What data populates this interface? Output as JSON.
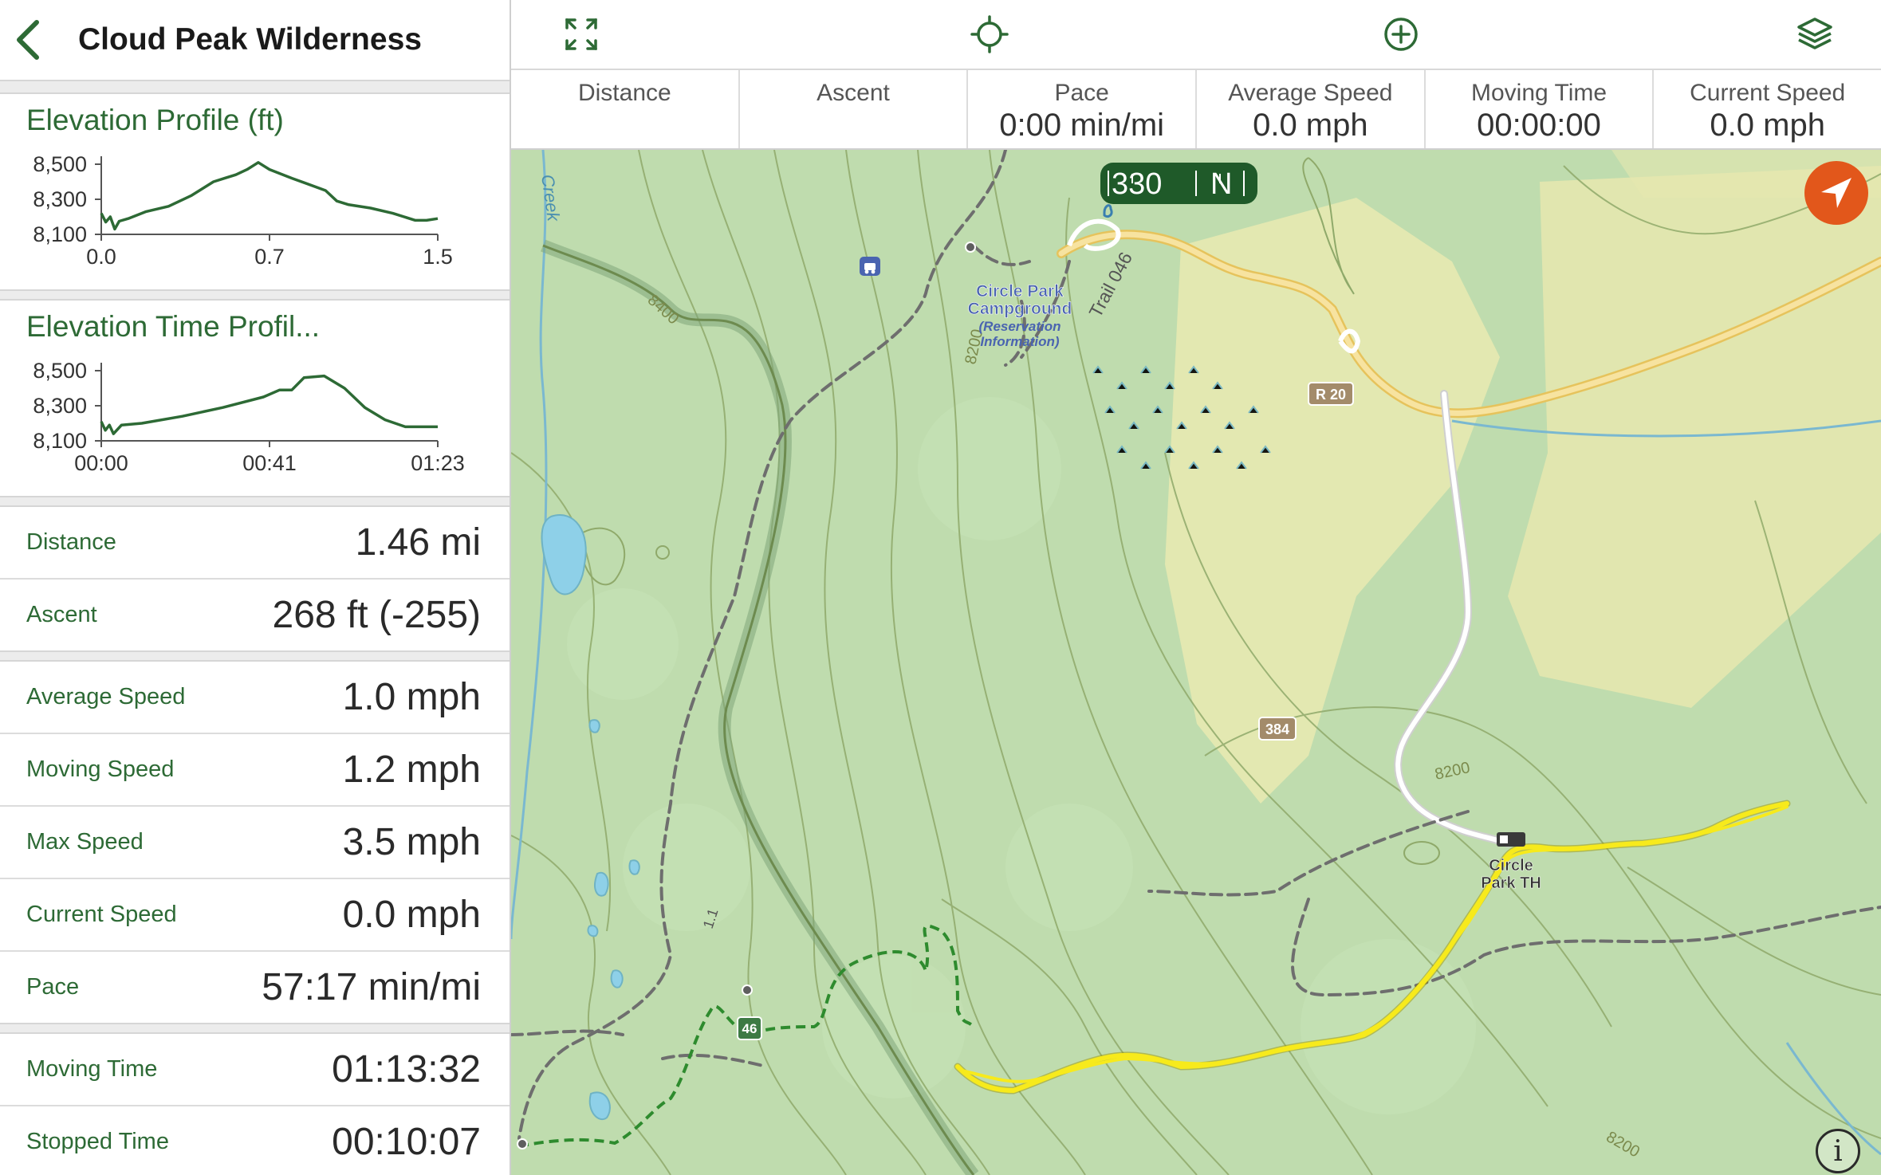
{
  "header": {
    "title": "Cloud Peak Wilderness"
  },
  "colors": {
    "accent": "#2d6a35",
    "track": "#f7ea1c",
    "fab": "#e2571b"
  },
  "charts": {
    "elevation_profile": {
      "title": "Elevation Profile (ft)",
      "y_ticks": [
        "8,500",
        "8,300",
        "8,100"
      ],
      "x_ticks": [
        "0.0",
        "0.7",
        "1.5"
      ]
    },
    "elevation_time": {
      "title": "Elevation Time Profil...",
      "y_ticks": [
        "8,500",
        "8,300",
        "8,100"
      ],
      "x_ticks": [
        "00:00",
        "00:41",
        "01:23"
      ]
    }
  },
  "chart_data": [
    {
      "type": "line",
      "title": "Elevation Profile (ft)",
      "xlabel": "",
      "ylabel": "",
      "ylim": [
        8100,
        8500
      ],
      "xlim": [
        0,
        1.5
      ],
      "series": [
        {
          "x": [
            0.0,
            0.02,
            0.04,
            0.06,
            0.08,
            0.12,
            0.2,
            0.3,
            0.4,
            0.5,
            0.55,
            0.6,
            0.65,
            0.7,
            0.75,
            0.85,
            1.0,
            1.05,
            1.1,
            1.2,
            1.3,
            1.4,
            1.45,
            1.5
          ],
          "values": [
            8220,
            8170,
            8200,
            8130,
            8175,
            8190,
            8230,
            8260,
            8320,
            8400,
            8420,
            8440,
            8470,
            8510,
            8470,
            8420,
            8350,
            8290,
            8270,
            8250,
            8220,
            8180,
            8180,
            8190
          ]
        }
      ]
    },
    {
      "type": "line",
      "title": "Elevation Time Profil...",
      "xlabel": "",
      "ylabel": "",
      "ylim": [
        8100,
        8500
      ],
      "xlim": [
        0,
        83
      ],
      "series": [
        {
          "x": [
            0,
            1,
            2,
            3,
            5,
            10,
            20,
            30,
            40,
            44,
            47,
            50,
            55,
            60,
            65,
            70,
            75,
            80,
            83
          ],
          "values": [
            8210,
            8160,
            8190,
            8140,
            8190,
            8200,
            8240,
            8290,
            8350,
            8390,
            8390,
            8460,
            8470,
            8400,
            8290,
            8220,
            8180,
            8180,
            8180
          ]
        }
      ]
    }
  ],
  "stats_groups": [
    [
      {
        "label": "Distance",
        "value": "1.46 mi"
      },
      {
        "label": "Ascent",
        "value": "268 ft (-255)"
      }
    ],
    [
      {
        "label": "Average Speed",
        "value": "1.0 mph"
      },
      {
        "label": "Moving Speed",
        "value": "1.2 mph"
      },
      {
        "label": "Max Speed",
        "value": "3.5 mph"
      },
      {
        "label": "Current Speed",
        "value": "0.0 mph"
      },
      {
        "label": "Pace",
        "value": "57:17 min/mi"
      }
    ],
    [
      {
        "label": "Moving Time",
        "value": "01:13:32"
      },
      {
        "label": "Stopped Time",
        "value": "00:10:07"
      }
    ]
  ],
  "toolbar": {
    "icons": [
      "expand-icon",
      "crosshair-icon",
      "add-circle-icon",
      "layers-icon"
    ]
  },
  "metrics": [
    {
      "label": "Distance",
      "value": ""
    },
    {
      "label": "Ascent",
      "value": ""
    },
    {
      "label": "Pace",
      "value": "0:00 min/mi"
    },
    {
      "label": "Average Speed",
      "value": "0.0 mph"
    },
    {
      "label": "Moving Time",
      "value": "00:00:00"
    },
    {
      "label": "Current Speed",
      "value": "0.0 mph"
    }
  ],
  "map": {
    "compass": {
      "heading": "330",
      "cardinal": "N"
    },
    "labels": {
      "creek": "Creek",
      "trail": "Trail 046",
      "contour_8400": "8400",
      "contour_8200_a": "8200",
      "contour_8200_b": "8200",
      "contour_8200_c": "8200",
      "campground_1": "Circle Park",
      "campground_2": "Campground",
      "campground_3": "(Reservation",
      "campground_4": "Information)",
      "road_r20": "R 20",
      "road_384": "384",
      "trailhead_1": "Circle",
      "trailhead_2": "Park TH",
      "trail_marker_46": "46",
      "trail_dist": "1.1"
    }
  }
}
